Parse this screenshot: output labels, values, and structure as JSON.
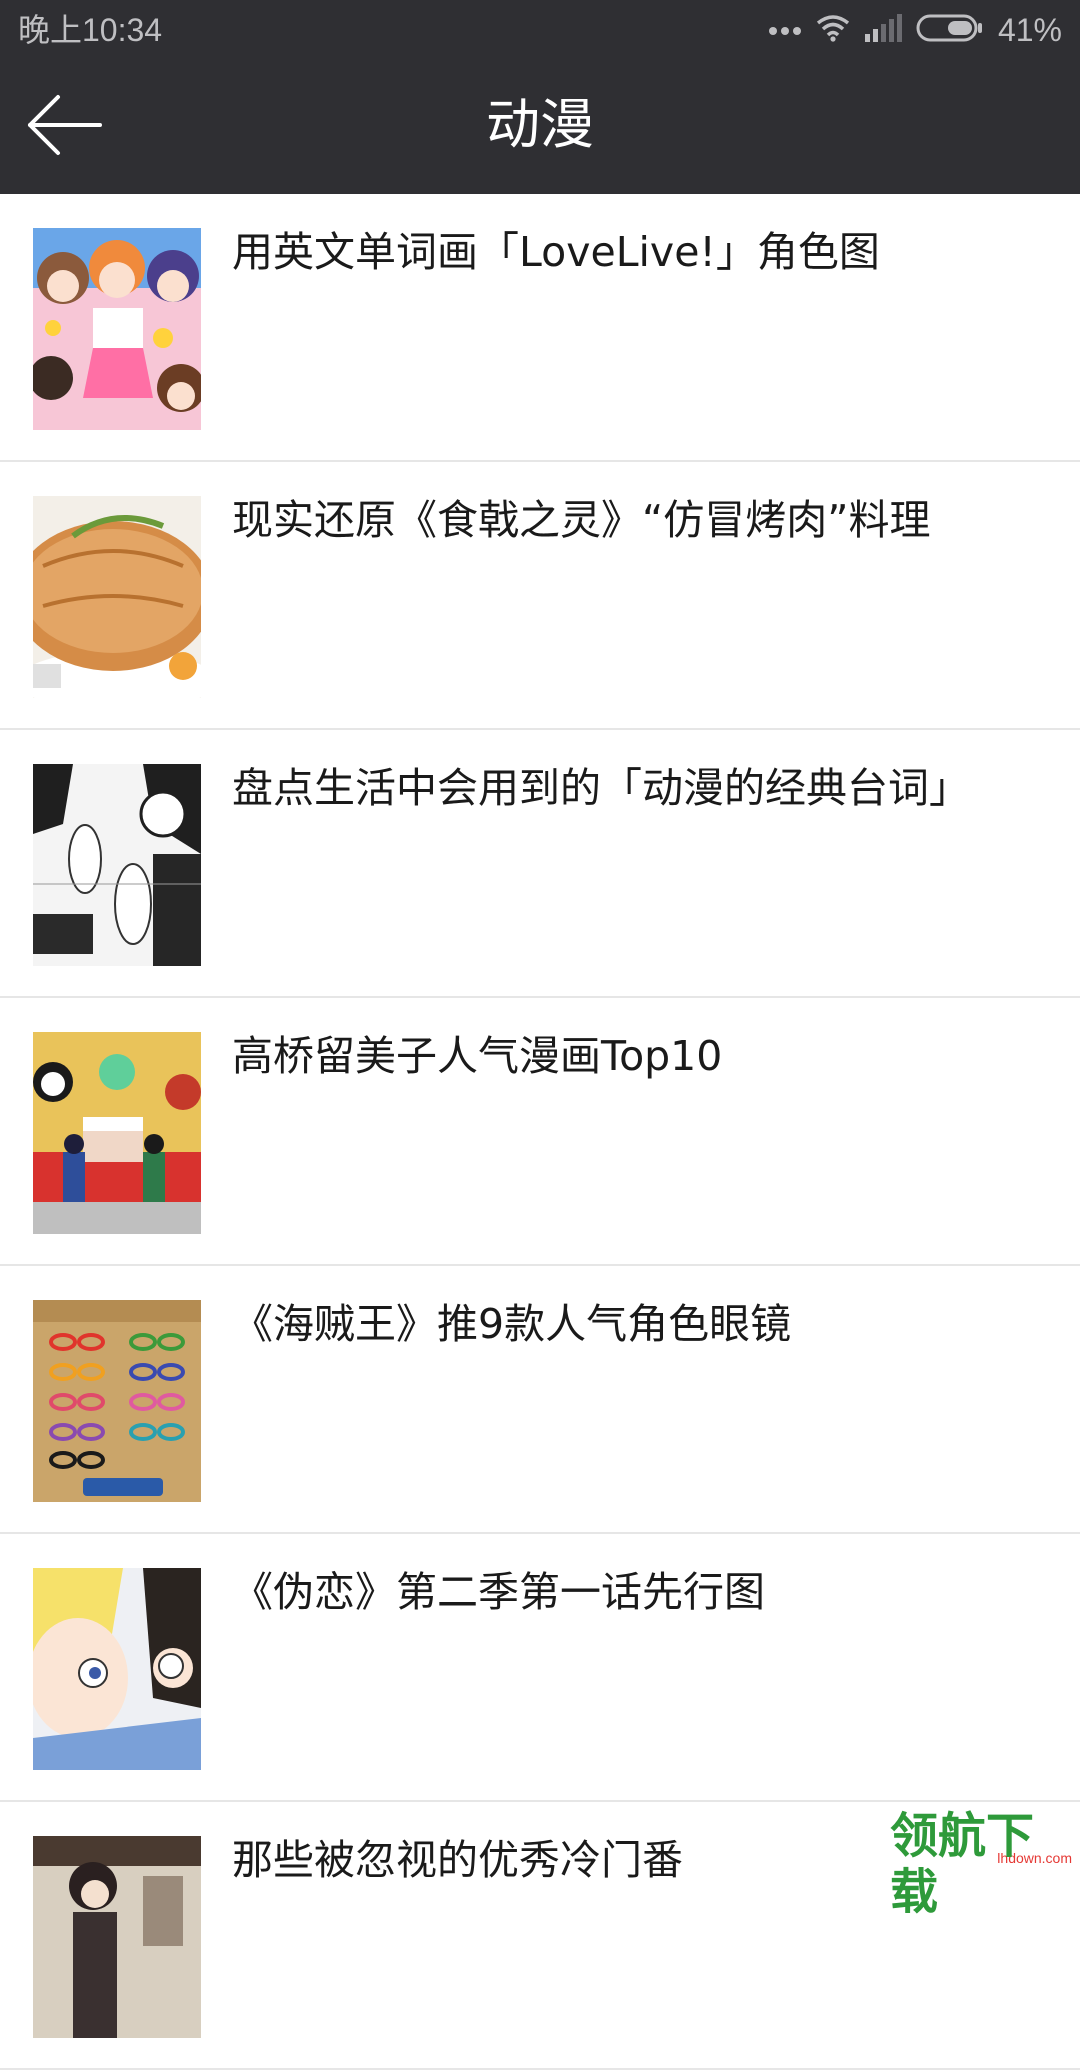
{
  "status_bar": {
    "time": "晚上10:34",
    "battery_percent": "41%",
    "icons": [
      "more-dots-icon",
      "wifi-icon",
      "signal-icon",
      "battery-icon"
    ]
  },
  "app_bar": {
    "title": "动漫",
    "back_icon": "arrow-left-icon"
  },
  "articles": [
    {
      "title": "用英文单词画「LoveLive!」角色图",
      "thumb": "colorful-anime-girls-group"
    },
    {
      "title": "现实还原《食戟之灵》“仿冒烤肉”料理",
      "thumb": "roast-meat-dish"
    },
    {
      "title": "盘点生活中会用到的「动漫的经典台词」",
      "thumb": "manga-page-bw"
    },
    {
      "title": "高桥留美子人气漫画Top10",
      "thumb": "rumiko-characters-party"
    },
    {
      "title": "《海贼王》推9款人气角色眼镜",
      "thumb": "one-piece-glasses-poster"
    },
    {
      "title": "《伪恋》第二季第一话先行图",
      "thumb": "nisekoi-scene"
    },
    {
      "title": "那些被忽视的优秀冷门番",
      "thumb": "anime-poster-dark"
    }
  ],
  "watermark": {
    "main": "领航下载",
    "sub": "lhdown.com"
  },
  "colors": {
    "app_bar": "#2f2f33",
    "divider": "#e6e6e6",
    "watermark_green": "#2e9a3a",
    "watermark_red": "#e53935"
  }
}
